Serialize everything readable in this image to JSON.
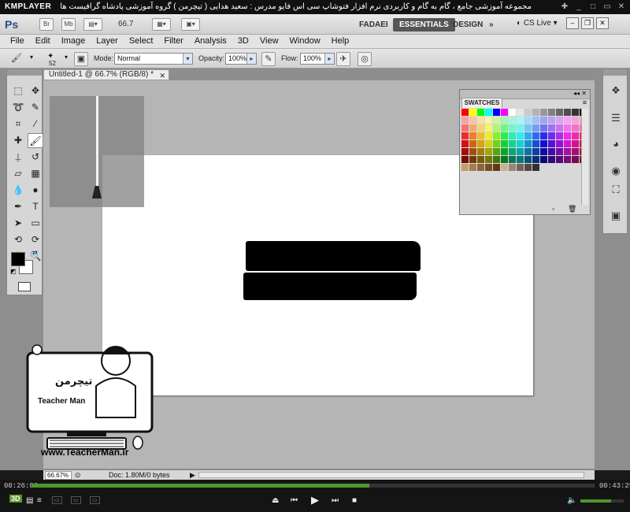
{
  "player": {
    "logo": "KMPLAYER",
    "caption": "مجموعه آموزشی جامع ، گام به گام و کاربردی نرم افزار فتوشاپ سی اس فایو  مدرس : سعید هدایی ( تیچرمن ) گروه آموزشی پادشاه گرافیست ها",
    "time_elapsed": "00:26:06",
    "time_total": "00:43:29",
    "progress": 0.6,
    "volume": 0.7,
    "badge_3d": "3D"
  },
  "app": {
    "logo": "Ps",
    "br_label": "Br",
    "mb_label": "Mb",
    "zoom": "66.7",
    "workspaces": [
      "FADAEI",
      "ESSENTIALS",
      "DESIGN"
    ],
    "active_workspace": "ESSENTIALS",
    "cslive": "CS Live"
  },
  "menu": [
    "File",
    "Edit",
    "Image",
    "Layer",
    "Select",
    "Filter",
    "Analysis",
    "3D",
    "View",
    "Window",
    "Help"
  ],
  "options": {
    "brush_size": "52",
    "mode_label": "Mode:",
    "mode_value": "Normal",
    "opacity_label": "Opacity:",
    "opacity_value": "100%",
    "flow_label": "Flow:",
    "flow_value": "100%"
  },
  "document": {
    "tab_title": "Untitled-1 @ 66.7% (RGB/8) *",
    "zoom_status": "66.67%",
    "doc_info": "Doc: 1.80M/0 bytes"
  },
  "swatches": {
    "title": "SWATCHES"
  },
  "watermark": {
    "url": "www.TeacherMan.ir",
    "name": "Teacher Man"
  },
  "colors": {
    "foreground": "#000000",
    "background": "#ffffff",
    "seek_fill": "#4a9a2a"
  }
}
